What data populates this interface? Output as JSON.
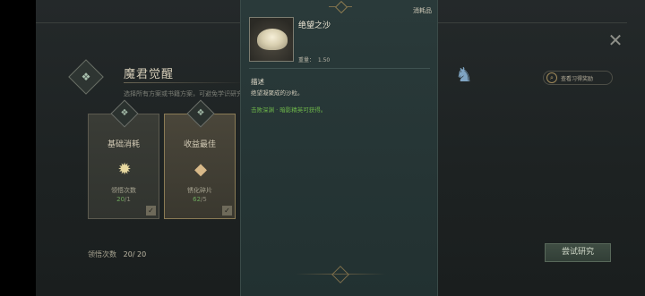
{
  "screen": {
    "section_title": "魔君觉醒",
    "section_subtitle": "选择所有方案或书籍方案，可避免学识研究",
    "close_icon": "close-icon"
  },
  "cards": [
    {
      "title": "基础消耗",
      "icon": "lightbulb-icon",
      "label": "领悟次数",
      "current": "20",
      "max": "/1",
      "checked": true
    },
    {
      "title": "收益最佳",
      "icon": "shard-icon",
      "label": "锈化碎片",
      "current": "62",
      "max": "/5",
      "checked": true
    },
    {
      "title": "",
      "icon": "faded-icon",
      "label": "",
      "current": "",
      "max": "",
      "checked": false
    }
  ],
  "comprehension": {
    "label": "领悟次数",
    "value": "20/ 20"
  },
  "view_reward_label": "查看习得奖励",
  "try_button_label": "尝试研究",
  "tooltip": {
    "category": "消耗品",
    "item_name": "绝望之沙",
    "weight_label": "重量：",
    "weight_value": "1.50",
    "description_heading": "描述",
    "description": "绝望凝聚成的沙粒。",
    "source": "击败深渊 · 暗影精英可获得。"
  },
  "colors": {
    "accent_green": "#6fb84a",
    "tooltip_bg": "#2a3a3a",
    "panel_bg": "#24292a"
  }
}
